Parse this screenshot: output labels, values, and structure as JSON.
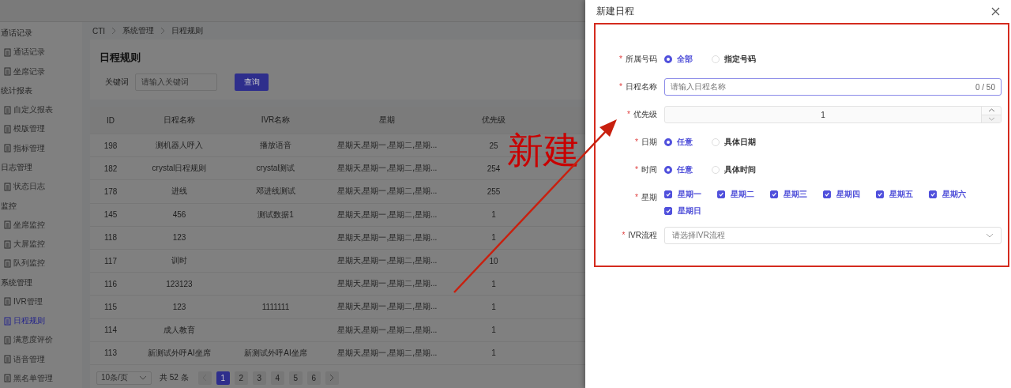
{
  "sidebar": {
    "groups": [
      {
        "label": "通话记录",
        "items": [
          {
            "label": "通话记录",
            "selected": false
          },
          {
            "label": "坐席记录",
            "selected": false
          }
        ]
      },
      {
        "label": "统计报表",
        "items": [
          {
            "label": "自定义报表",
            "selected": false
          },
          {
            "label": "模版管理",
            "selected": false
          },
          {
            "label": "指标管理",
            "selected": false
          }
        ]
      },
      {
        "label": "日志管理",
        "items": [
          {
            "label": "状态日志",
            "selected": false
          }
        ]
      },
      {
        "label": "监控",
        "items": [
          {
            "label": "坐席监控",
            "selected": false
          },
          {
            "label": "大屏监控",
            "selected": false
          },
          {
            "label": "队列监控",
            "selected": false
          }
        ]
      },
      {
        "label": "系统管理",
        "items": [
          {
            "label": "IVR管理",
            "selected": false
          },
          {
            "label": "日程规则",
            "selected": true
          },
          {
            "label": "满意度评价",
            "selected": false
          },
          {
            "label": "语音管理",
            "selected": false
          },
          {
            "label": "黑名单管理",
            "selected": false
          }
        ]
      }
    ]
  },
  "breadcrumb": [
    "CTI",
    "系统管理",
    "日程规则"
  ],
  "page_title": "日程规则",
  "search": {
    "label": "关键词",
    "placeholder": "请输入关键词",
    "button": "查询"
  },
  "table": {
    "columns": [
      "ID",
      "日程名称",
      "IVR名称",
      "星期",
      "优先级"
    ],
    "rows": [
      [
        "198",
        "测机器人呼入",
        "播放语音",
        "星期天,星期一,星期二,星期...",
        "25"
      ],
      [
        "182",
        "crystal日程规则",
        "crystal测试",
        "星期天,星期一,星期二,星期...",
        "254"
      ],
      [
        "178",
        "进线",
        "邓进线测试",
        "星期天,星期一,星期二,星期...",
        "255"
      ],
      [
        "145",
        "456",
        "测试数据1",
        "星期天,星期一,星期二,星期...",
        "1"
      ],
      [
        "118",
        "123",
        "",
        "星期天,星期一,星期二,星期...",
        "1"
      ],
      [
        "117",
        "训时",
        "",
        "星期天,星期一,星期二,星期...",
        "10"
      ],
      [
        "116",
        "123123",
        "",
        "星期天,星期一,星期二,星期...",
        "1"
      ],
      [
        "115",
        "123",
        "1111111",
        "星期天,星期一,星期二,星期...",
        "1"
      ],
      [
        "114",
        "成人教育",
        "",
        "星期天,星期一,星期二,星期...",
        "1"
      ],
      [
        "113",
        "新测试外呼AI坐席",
        "新测试外呼AI坐席",
        "星期天,星期一,星期二,星期...",
        "1"
      ]
    ]
  },
  "pagination": {
    "page_size": "10条/页",
    "total": "共 52 条",
    "pages": [
      {
        "label": "1",
        "selected": true
      },
      {
        "label": "2",
        "selected": false
      },
      {
        "label": "3",
        "selected": false
      },
      {
        "label": "4",
        "selected": false
      },
      {
        "label": "5",
        "selected": false
      },
      {
        "label": "6",
        "selected": false
      }
    ]
  },
  "drawer": {
    "title": "新建日程",
    "fields": [
      {
        "kind": "radio",
        "required_mark": "*",
        "label": "所属号码",
        "options": [
          {
            "label": "全部",
            "selected": true
          },
          {
            "label": "指定号码",
            "selected": false
          }
        ]
      },
      {
        "kind": "text",
        "required_mark": "*",
        "label": "日程名称",
        "placeholder": "请输入日程名称",
        "counter": "0 / 50"
      },
      {
        "kind": "number",
        "required_mark": "*",
        "label": "优先级",
        "value": "1"
      },
      {
        "kind": "radio",
        "required_mark": "*",
        "label": "日期",
        "options": [
          {
            "label": "任意",
            "selected": true
          },
          {
            "label": "具体日期",
            "selected": false
          }
        ]
      },
      {
        "kind": "radio",
        "required_mark": "*",
        "label": "时间",
        "options": [
          {
            "label": "任意",
            "selected": true
          },
          {
            "label": "具体时间",
            "selected": false
          }
        ]
      },
      {
        "kind": "checkbox",
        "required_mark": "*",
        "label": "星期",
        "options": [
          {
            "label": "星期一",
            "checked": true
          },
          {
            "label": "星期二",
            "checked": true
          },
          {
            "label": "星期三",
            "checked": true
          },
          {
            "label": "星期四",
            "checked": true
          },
          {
            "label": "星期五",
            "checked": true
          },
          {
            "label": "星期六",
            "checked": true
          },
          {
            "label": "星期日",
            "checked": true
          }
        ]
      },
      {
        "kind": "select",
        "required_mark": "*",
        "label": "IVR流程",
        "placeholder": "请选择IVR流程"
      }
    ]
  },
  "annotation": {
    "text": "新建"
  }
}
